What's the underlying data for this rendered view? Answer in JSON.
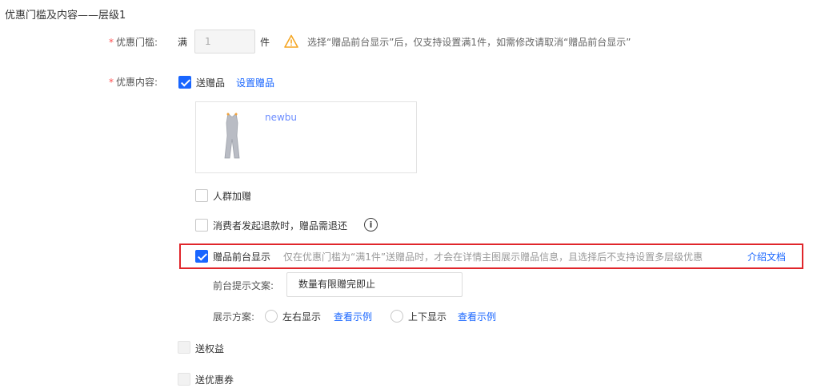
{
  "section_title": "优惠门槛及内容——层级1",
  "threshold": {
    "required_mark": "*",
    "label": "优惠门槛:",
    "prefix": "满",
    "value": "1",
    "unit": "件",
    "warning_icon": "warning-triangle-icon",
    "warning_text": "选择“赠品前台显示”后，仅支持设置满1件，如需修改请取消“赠品前台显示”"
  },
  "content": {
    "required_mark": "*",
    "label": "优惠内容:",
    "send_gift": {
      "label": "送赠品",
      "checked": true,
      "setup_link": "设置赠品"
    },
    "gift_item": {
      "name": "newbu",
      "image_icon": "jumpsuit-thumbnail"
    },
    "crowd_gift": {
      "label": "人群加赠",
      "checked": false
    },
    "refund_return": {
      "label": "消费者发起退款时，赠品需退还",
      "checked": false,
      "info_icon": "i"
    },
    "front_display": {
      "label": "赠品前台显示",
      "checked": true,
      "description": "仅在优惠门槛为“满1件”送赠品时，才会在详情主图展示赠品信息，且选择后不支持设置多层级优惠",
      "doc_link": "介绍文档"
    },
    "tip_text": {
      "label": "前台提示文案:",
      "value": "数量有限赠完即止"
    },
    "display_scheme": {
      "label": "展示方案:",
      "options": [
        {
          "label": "左右显示",
          "example_link": "查看示例"
        },
        {
          "label": "上下显示",
          "example_link": "查看示例"
        }
      ]
    },
    "send_rights": {
      "label": "送权益",
      "checked": false
    },
    "send_coupon": {
      "label": "送优惠券",
      "checked": false
    }
  },
  "colors": {
    "accent": "#1966ff",
    "required": "#ff4d4f",
    "warning": "#f5a623",
    "highlight_border": "#e0262b"
  }
}
